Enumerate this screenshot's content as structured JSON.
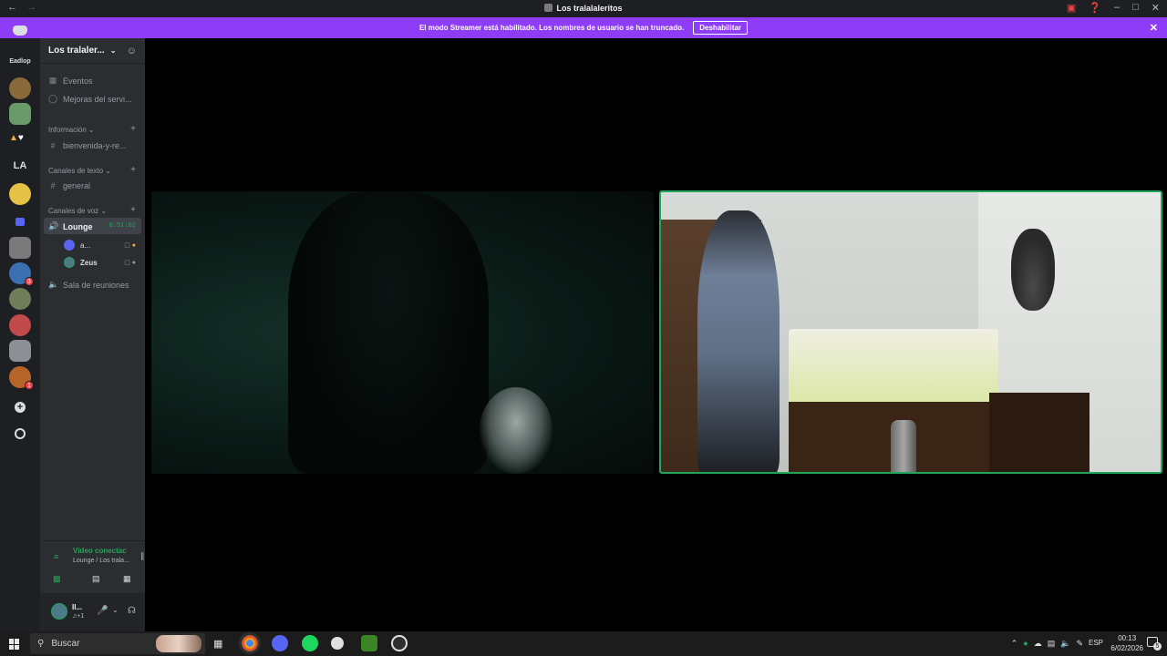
{
  "window": {
    "title": "Los tralalaleritos",
    "back_icon": "arrow-left-icon",
    "forward_icon": "arrow-right-icon"
  },
  "banner": {
    "message": "El modo Streamer está habilitado. Los nombres de usuario se han truncado.",
    "button": "Deshabilitar"
  },
  "servers": {
    "folder_label": "Eadlop",
    "la_label": "LA",
    "badges": [
      "3",
      "1"
    ]
  },
  "guild": {
    "name": "Los tralaler...",
    "events": "Eventos",
    "boost": "Mejoras del servi...",
    "categories": [
      {
        "name": "Información",
        "channels": [
          "bienvenida-y-re..."
        ]
      },
      {
        "name": "Canales de texto",
        "channels": [
          "general"
        ]
      },
      {
        "name": "Canales de voz",
        "channels": [
          "Lounge",
          "Sala de reuniones"
        ]
      }
    ],
    "lounge_timer": "6:51:02",
    "members": [
      {
        "name": "a..."
      },
      {
        "name": "Zeus"
      }
    ]
  },
  "voice": {
    "status": "Vídeo conectac",
    "location": "Lounge / Los trala..."
  },
  "user": {
    "name": "Il...",
    "status": "♫+1"
  },
  "taskbar": {
    "search_placeholder": "Buscar",
    "lang": "ESP",
    "time": "00:13",
    "date": "6/02/2026",
    "notif_count": "5"
  },
  "colors": {
    "accent": "#8f3cf7",
    "speaking_border": "#23a55a",
    "voice_green": "#23a55a"
  }
}
